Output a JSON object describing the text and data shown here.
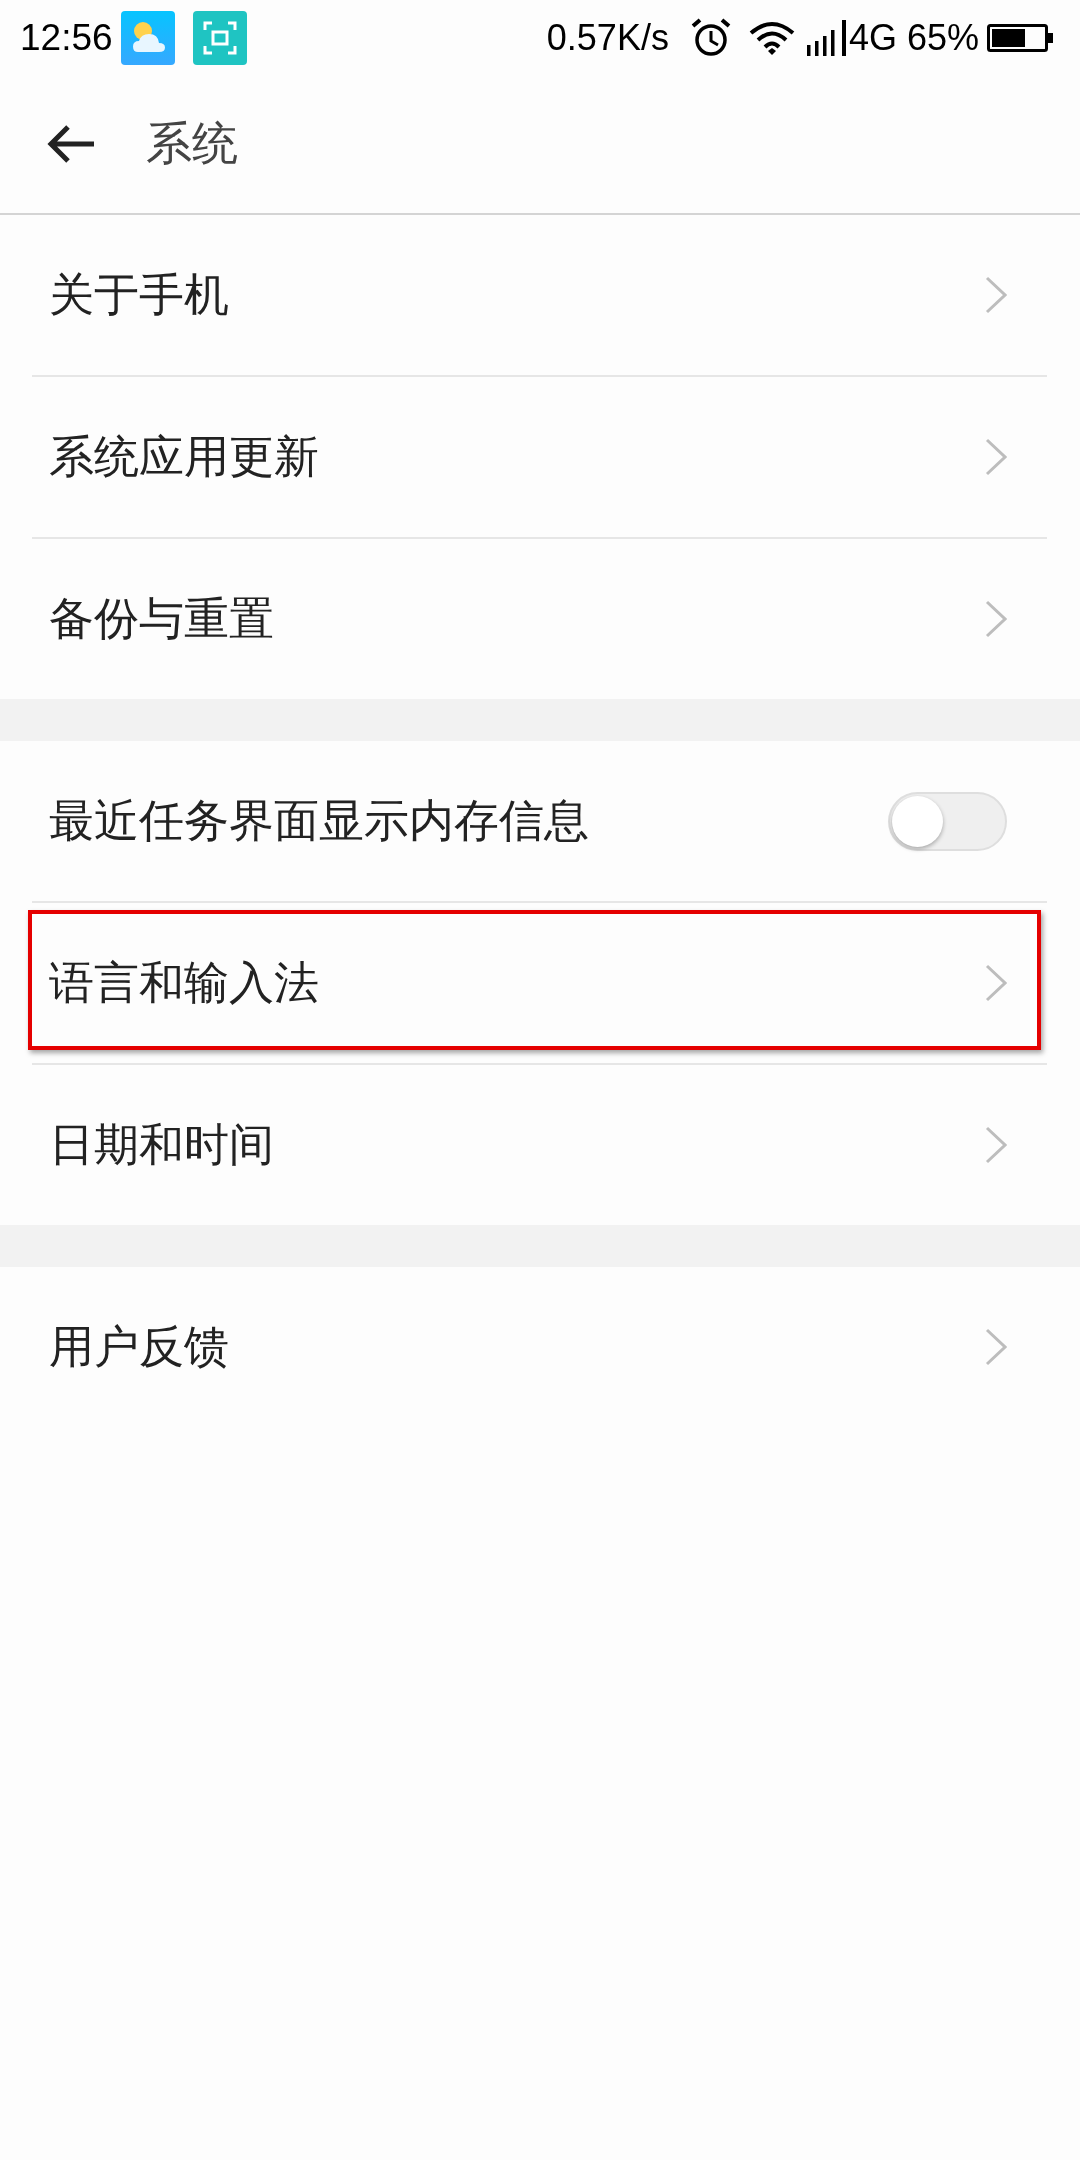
{
  "status_bar": {
    "time": "12:56",
    "net_speed": "0.57K/s",
    "network_type": "4G",
    "battery_percent": "65%"
  },
  "header": {
    "title": "系统"
  },
  "sections": [
    {
      "items": [
        {
          "kind": "link",
          "label": "关于手机",
          "highlighted": false
        },
        {
          "kind": "link",
          "label": "系统应用更新",
          "highlighted": false
        },
        {
          "kind": "link",
          "label": "备份与重置",
          "highlighted": false
        }
      ]
    },
    {
      "items": [
        {
          "kind": "toggle",
          "label": "最近任务界面显示内存信息",
          "on": false,
          "highlighted": false
        },
        {
          "kind": "link",
          "label": "语言和输入法",
          "highlighted": true
        },
        {
          "kind": "link",
          "label": "日期和时间",
          "highlighted": false
        }
      ]
    },
    {
      "items": [
        {
          "kind": "link",
          "label": "用户反馈",
          "highlighted": false
        }
      ]
    }
  ]
}
